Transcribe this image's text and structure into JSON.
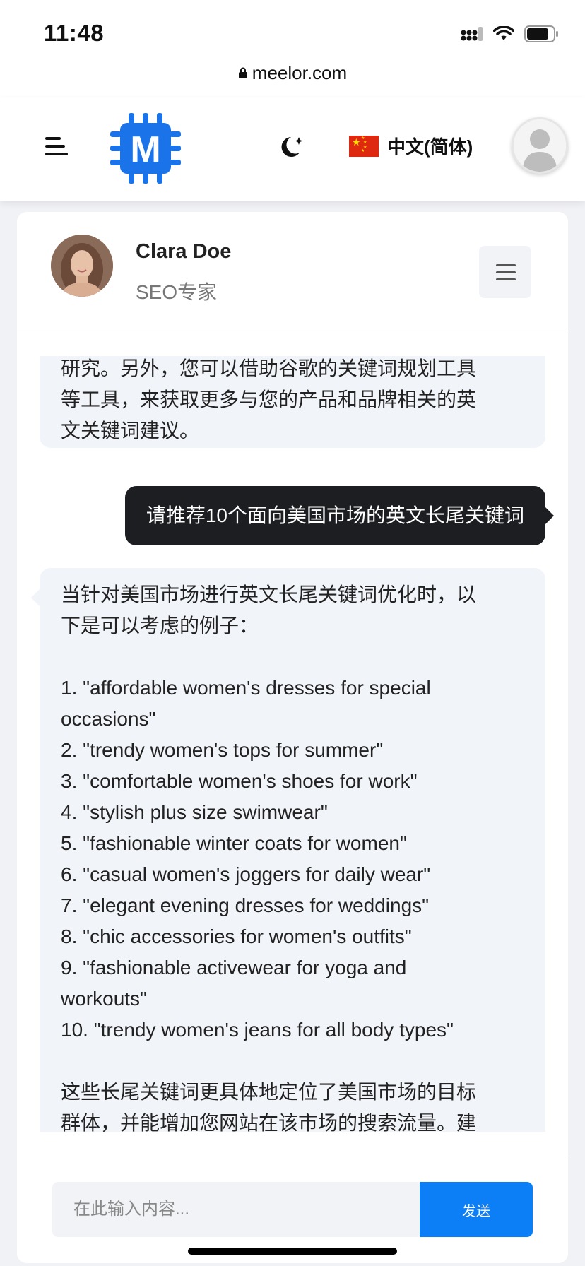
{
  "status_bar": {
    "time": "11:48",
    "icons": [
      "signal-icon",
      "wifi-icon",
      "battery-icon"
    ]
  },
  "browser": {
    "url": "meelor.com"
  },
  "header": {
    "logo_letter": "M",
    "language_label": "中文(简体)",
    "brand_color": "#1a73e8"
  },
  "chat": {
    "contact": {
      "name": "Clara Doe",
      "role": "SEO专家"
    },
    "messages": {
      "prev_bot_lines": [
        "研究。另外，您可以借助谷歌的关键词规划工具",
        "等工具，来获取更多与您的产品和品牌相关的英",
        "文关键词建议。"
      ],
      "user_message": "请推荐10个面向美国市场的英文长尾关键词",
      "bot_intro_lines": [
        "当针对美国市场进行英文长尾关键词优化时，以",
        "下是可以考虑的例子："
      ],
      "keywords": [
        "1. \"affordable women's dresses for special",
        "occasions\"",
        "2. \"trendy women's tops for summer\"",
        "3. \"comfortable women's shoes for work\"",
        "4. \"stylish plus size swimwear\"",
        "5. \"fashionable winter coats for women\"",
        "6. \"casual women's joggers for daily wear\"",
        "7. \"elegant evening dresses for weddings\"",
        "8. \"chic accessories for women's outfits\"",
        "9. \"fashionable activewear for yoga and",
        "workouts\"",
        "10. \"trendy women's jeans for all body types\""
      ],
      "bot_outro_lines": [
        "这些长尾关键词更具体地定位了美国市场的目标",
        "群体，并能增加您网站在该市场的搜索流量。建"
      ]
    },
    "composer": {
      "placeholder": "在此输入内容...",
      "send_label": "发送"
    }
  },
  "colors": {
    "accent": "#0d7ff6",
    "user_bubble": "#1c1e22",
    "bot_bubble": "#f1f4f9"
  }
}
